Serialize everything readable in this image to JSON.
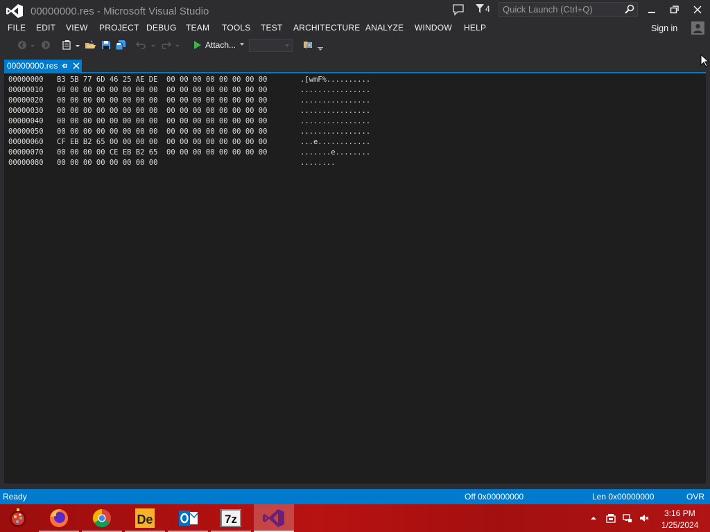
{
  "window": {
    "title": "00000000.res - Microsoft Visual Studio",
    "notification_count": "4",
    "quick_launch_placeholder": "Quick Launch (Ctrl+Q)",
    "accent_color": "#007acc",
    "icons": [
      "vs-logo",
      "feedback-icon",
      "notification-flag-icon",
      "search-icon",
      "minimize-icon",
      "restore-icon",
      "close-icon"
    ]
  },
  "menu": {
    "items": [
      "FILE",
      "EDIT",
      "VIEW",
      "PROJECT",
      "DEBUG",
      "TEAM",
      "TOOLS",
      "TEST",
      "ARCHITECTURE",
      "ANALYZE",
      "WINDOW",
      "HELP"
    ],
    "sign_in": "Sign in"
  },
  "toolbar": {
    "attach_label": "Attach...",
    "configuration_value": "",
    "icons": [
      "back-icon",
      "forward-icon",
      "new-project-icon",
      "open-file-icon",
      "save-icon",
      "save-all-icon",
      "undo-icon",
      "redo-icon",
      "start-icon",
      "find-in-files-icon"
    ]
  },
  "tab": {
    "label": "00000000.res",
    "pinned": true
  },
  "hex": {
    "rows": [
      {
        "offset": "00000000",
        "bytes": "B3 5B 77 6D 46 25 AE DE  00 00 00 00 00 00 00 00",
        "ascii": ".[wmF%.........."
      },
      {
        "offset": "00000010",
        "bytes": "00 00 00 00 00 00 00 00  00 00 00 00 00 00 00 00",
        "ascii": "................"
      },
      {
        "offset": "00000020",
        "bytes": "00 00 00 00 00 00 00 00  00 00 00 00 00 00 00 00",
        "ascii": "................"
      },
      {
        "offset": "00000030",
        "bytes": "00 00 00 00 00 00 00 00  00 00 00 00 00 00 00 00",
        "ascii": "................"
      },
      {
        "offset": "00000040",
        "bytes": "00 00 00 00 00 00 00 00  00 00 00 00 00 00 00 00",
        "ascii": "................"
      },
      {
        "offset": "00000050",
        "bytes": "00 00 00 00 00 00 00 00  00 00 00 00 00 00 00 00",
        "ascii": "................"
      },
      {
        "offset": "00000060",
        "bytes": "CF EB B2 65 00 00 00 00  00 00 00 00 00 00 00 00",
        "ascii": "...e............"
      },
      {
        "offset": "00000070",
        "bytes": "00 00 00 00 CE EB B2 65  00 00 00 00 00 00 00 00",
        "ascii": ".......e........"
      },
      {
        "offset": "00000080",
        "bytes": "00 00 00 00 00 00 00 00",
        "ascii": "........"
      }
    ]
  },
  "status": {
    "left": "Ready",
    "offset": "Off 0x00000000",
    "length": "Len 0x00000000",
    "mode": "OVR"
  },
  "taskbar": {
    "apps": [
      "start-orb",
      "firefox",
      "chrome",
      "dependency-walker",
      "outlook",
      "7-zip",
      "visual-studio"
    ],
    "active_app": "visual-studio",
    "tray_icons": [
      "show-hidden-icons-chevron",
      "action-center-icon",
      "network-icon",
      "volume-muted-icon"
    ],
    "time": "3:16 PM",
    "date": "1/25/2024",
    "background_color": "#b01414"
  }
}
